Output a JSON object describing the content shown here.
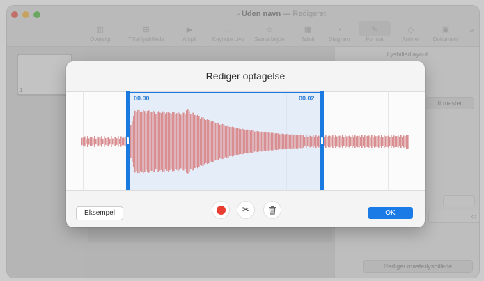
{
  "window": {
    "title": "Uden navn",
    "separator": "—",
    "subtitle": "Redigeret"
  },
  "toolbar": {
    "items": [
      {
        "label": "Oversigt",
        "icon": "sidebar-icon"
      },
      {
        "label": "Tilføj lysbillede",
        "icon": "add-slide-icon"
      },
      {
        "label": "Afspil",
        "icon": "play-icon"
      },
      {
        "label": "Keynote Live",
        "icon": "keynote-live-icon"
      },
      {
        "label": "Samarbejde",
        "icon": "collaborate-icon"
      },
      {
        "label": "Tabel",
        "icon": "table-icon"
      },
      {
        "label": "Diagram",
        "icon": "chart-icon"
      },
      {
        "label": "Format",
        "icon": "format-brush-icon"
      },
      {
        "label": "Animer",
        "icon": "animate-diamond-icon"
      },
      {
        "label": "Dokument",
        "icon": "document-icon"
      }
    ],
    "overflow_symbol": "»"
  },
  "navigator": {
    "slide_number": "1"
  },
  "inspector": {
    "title": "Lysbilledlayout",
    "master_button_partial": "ft master",
    "edit_master_button": "Rediger masterlysbillede"
  },
  "dialog": {
    "title": "Rediger optagelse",
    "start_time": "00.00",
    "end_time": "00.02",
    "preview_button": "Eksempel",
    "ok_button": "OK",
    "cut_symbol": "✂"
  },
  "colors": {
    "accent": "#1a7ae6",
    "waveform": "#d98f91",
    "record": "#ea3d32",
    "selection": "#d4e2f6"
  }
}
